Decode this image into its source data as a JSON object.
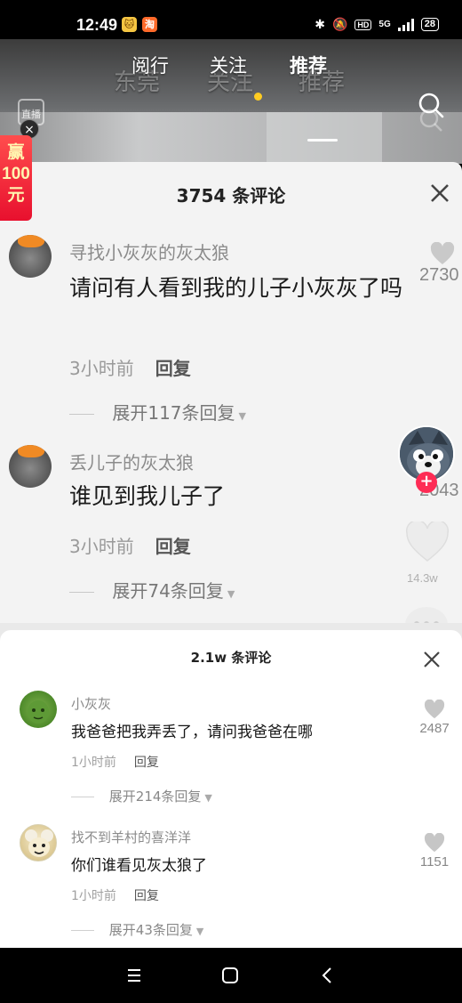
{
  "status_bar": {
    "time": "12:49",
    "app_badge_1": "🐱",
    "app_badge_2": "淘",
    "network": "5G",
    "hd": "HD",
    "battery": "28"
  },
  "top_nav": {
    "tab_live": "直播",
    "tab_city": "阅行",
    "tab_follow": "关注",
    "tab_recommend": "推荐",
    "ghost_live": "直播",
    "ghost_city": "东莞",
    "ghost_follow": "关注",
    "ghost_recommend": "推荐"
  },
  "promo": {
    "line1": "赢",
    "line2": "100",
    "line3": "元"
  },
  "bg_sheet": {
    "title": "3754 条评论",
    "comments": [
      {
        "name": "寻找小灰灰的灰太狼",
        "text": "请问有人看到我的儿子小灰灰了吗",
        "time": "3小时前",
        "reply": "回复",
        "expand": "展开117条回复",
        "likes": "2730"
      },
      {
        "name": "丢儿子的灰太狼",
        "text": "谁见到我儿子了",
        "time": "3小时前",
        "reply": "回复",
        "expand": "展开74条回复",
        "likes": "2043"
      }
    ],
    "side_count": "14.3w"
  },
  "fg_sheet": {
    "title": "2.1w 条评论",
    "comments": [
      {
        "name": "小灰灰",
        "text": "我爸爸把我弄丢了，请问我爸爸在哪",
        "time": "1小时前",
        "reply": "回复",
        "expand": "展开214条回复",
        "likes": "2487"
      },
      {
        "name": "找不到羊村的喜洋洋",
        "text": "你们谁看见灰太狼了",
        "time": "1小时前",
        "reply": "回复",
        "expand": "展开43条回复",
        "likes": "1151"
      }
    ]
  }
}
